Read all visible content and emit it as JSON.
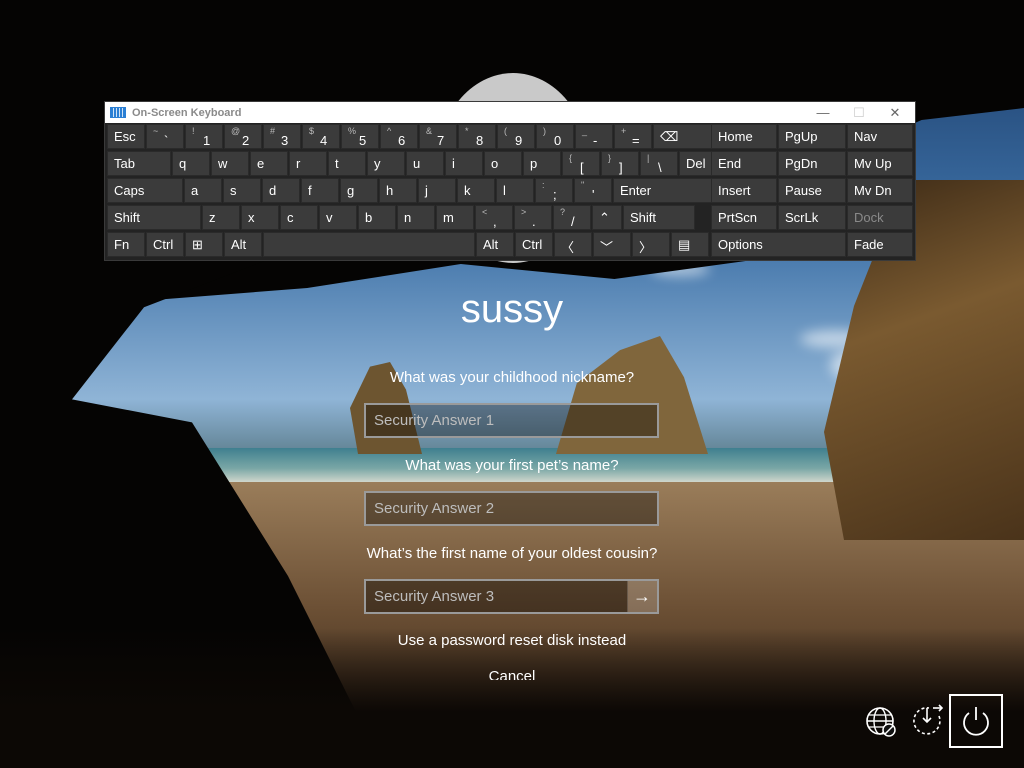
{
  "osk": {
    "title": "On-Screen Keyboard",
    "min_glyph": "—",
    "max_glyph": "☐",
    "close_glyph": "✕",
    "rows": [
      [
        {
          "l": "Esc"
        },
        {
          "s": "~",
          "b": "`"
        },
        {
          "s": "!",
          "b": "1"
        },
        {
          "s": "@",
          "b": "2"
        },
        {
          "s": "#",
          "b": "3"
        },
        {
          "s": "$",
          "b": "4"
        },
        {
          "s": "%",
          "b": "5"
        },
        {
          "s": "^",
          "b": "6"
        },
        {
          "s": "&",
          "b": "7"
        },
        {
          "s": "*",
          "b": "8"
        },
        {
          "s": "(",
          "b": "9"
        },
        {
          "s": ")",
          "b": "0"
        },
        {
          "s": "_",
          "b": "-"
        },
        {
          "s": "+",
          "b": "="
        },
        {
          "l": "⌫"
        }
      ],
      [
        {
          "l": "Tab"
        },
        {
          "l": "q"
        },
        {
          "l": "w"
        },
        {
          "l": "e"
        },
        {
          "l": "r"
        },
        {
          "l": "t"
        },
        {
          "l": "y"
        },
        {
          "l": "u"
        },
        {
          "l": "i"
        },
        {
          "l": "o"
        },
        {
          "l": "p"
        },
        {
          "s": "{",
          "b": "["
        },
        {
          "s": "}",
          "b": "]"
        },
        {
          "s": "|",
          "b": "\\"
        },
        {
          "l": "Del"
        }
      ],
      [
        {
          "l": "Caps"
        },
        {
          "l": "a"
        },
        {
          "l": "s"
        },
        {
          "l": "d"
        },
        {
          "l": "f"
        },
        {
          "l": "g"
        },
        {
          "l": "h"
        },
        {
          "l": "j"
        },
        {
          "l": "k"
        },
        {
          "l": "l"
        },
        {
          "s": ":",
          "b": ";"
        },
        {
          "s": "\"",
          "b": "'"
        },
        {
          "l": "Enter"
        }
      ],
      [
        {
          "l": "Shift"
        },
        {
          "l": "z"
        },
        {
          "l": "x"
        },
        {
          "l": "c"
        },
        {
          "l": "v"
        },
        {
          "l": "b"
        },
        {
          "l": "n"
        },
        {
          "l": "m"
        },
        {
          "s": "<",
          "b": ","
        },
        {
          "s": ">",
          "b": "."
        },
        {
          "s": "?",
          "b": "/"
        },
        {
          "l": "⌃"
        },
        {
          "l": "Shift"
        }
      ],
      [
        {
          "l": "Fn"
        },
        {
          "l": "Ctrl"
        },
        {
          "l": "⊞"
        },
        {
          "l": "Alt"
        },
        {
          "l": ""
        },
        {
          "l": "Alt"
        },
        {
          "l": "Ctrl"
        },
        {
          "l": "〈"
        },
        {
          "l": "﹀"
        },
        {
          "l": "〉"
        },
        {
          "l": "▤"
        }
      ]
    ],
    "nav_keys": [
      [
        "Home",
        "PgUp",
        "Nav"
      ],
      [
        "End",
        "PgDn",
        "Mv Up"
      ],
      [
        "Insert",
        "Pause",
        "Mv Dn"
      ],
      [
        "PrtScn",
        "ScrLk",
        "Dock"
      ],
      [
        "Options",
        "Fade"
      ]
    ]
  },
  "login": {
    "username": "sussy",
    "questions": [
      "What was your childhood nickname?",
      "What was your first pet’s name?",
      "What’s the first name of your oldest cousin?"
    ],
    "answer_placeholders": [
      "Security Answer 1",
      "Security Answer 2",
      "Security Answer 3"
    ],
    "submit_glyph": "→",
    "reset_link": "Use a password reset disk instead",
    "cancel_link": "Cancel"
  },
  "corner_icons": [
    "network-icon",
    "ease-of-access-icon",
    "power-icon"
  ]
}
